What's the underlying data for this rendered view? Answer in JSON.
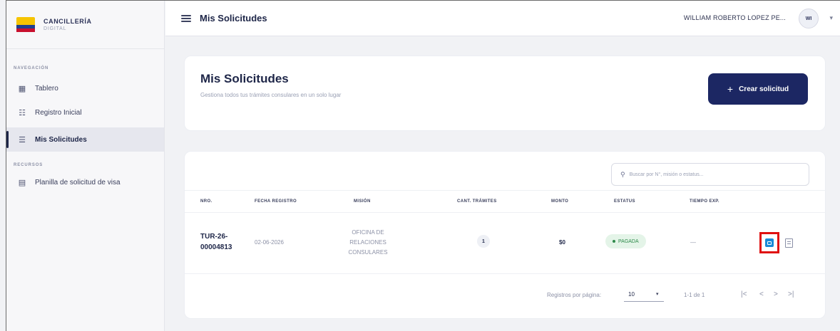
{
  "brand": {
    "title": "CANCILLERÍA",
    "subtitle": "DIGITAL"
  },
  "sidebar": {
    "sections": [
      {
        "label": "NAVEGACIÓN"
      },
      {
        "label": "RECURSOS"
      }
    ],
    "items": [
      {
        "label": "Tablero",
        "icon": "dashboard-icon"
      },
      {
        "label": "Registro Inicial",
        "icon": "registro-icon"
      },
      {
        "label": "Mis Solicitudes",
        "icon": "list-icon",
        "active": true
      },
      {
        "label": "Planilla de solicitud de visa",
        "icon": "document-icon"
      }
    ]
  },
  "topbar": {
    "title": "Mis Solicitudes",
    "user_name": "WILLIAM ROBERTO LOPEZ PE...",
    "avatar_initials": "WI",
    "caret": "▾"
  },
  "header_card": {
    "title": "Mis Solicitudes",
    "subtitle": "Gestiona todos tus trámites consulares en un solo lugar",
    "create_button": "Crear solicitud",
    "create_icon": "+"
  },
  "table": {
    "search_placeholder": "Buscar por N°, misión o estatus...",
    "columns": [
      "NRO.",
      "FECHA REGISTRO",
      "MISIÓN",
      "CANT. TRÁMITES",
      "MONTO",
      "ESTATUS",
      "TIEMPO EXP."
    ],
    "rows": [
      {
        "nro_line1": "TUR-26-",
        "nro_line2": "00004813",
        "fecha": "02-06-2026",
        "mision_line1": "OFICINA DE",
        "mision_line2": "RELACIONES",
        "mision_line3": "CONSULARES",
        "cant": "1",
        "monto": "$0",
        "estatus": "PAGADA",
        "tiempo": "—"
      }
    ],
    "pager": {
      "label": "Registros por página:",
      "size": "10",
      "size_caret": "▾",
      "range": "1-1 de 1",
      "first": "|<",
      "prev": "<",
      "next": ">",
      "last": ">|"
    }
  },
  "colors": {
    "primary": "#1c2763",
    "status_paid_bg": "#e4f4e8",
    "status_paid_fg": "#2e8a4a",
    "view_button": "#1a8ad6",
    "highlight": "#e01010"
  }
}
